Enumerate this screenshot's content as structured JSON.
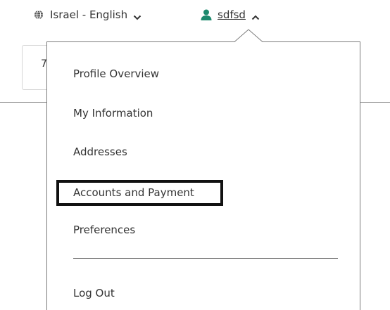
{
  "header": {
    "locale_label": "Israel - English",
    "username": "sdfsd"
  },
  "background": {
    "input_value": "7"
  },
  "menu": {
    "items": [
      {
        "label": "Profile Overview"
      },
      {
        "label": "My Information"
      },
      {
        "label": "Addresses"
      },
      {
        "label": "Accounts and Payment",
        "highlighted": true
      },
      {
        "label": "Preferences"
      },
      {
        "label": "Log Out"
      }
    ]
  },
  "colors": {
    "accent_user_icon": "#1e8a6e",
    "text": "#333333",
    "highlight_border": "#111111"
  },
  "icons": {
    "locale": "globe-icon",
    "locale_toggle": "chevron-down-icon",
    "user": "user-icon",
    "user_toggle": "chevron-up-icon"
  }
}
